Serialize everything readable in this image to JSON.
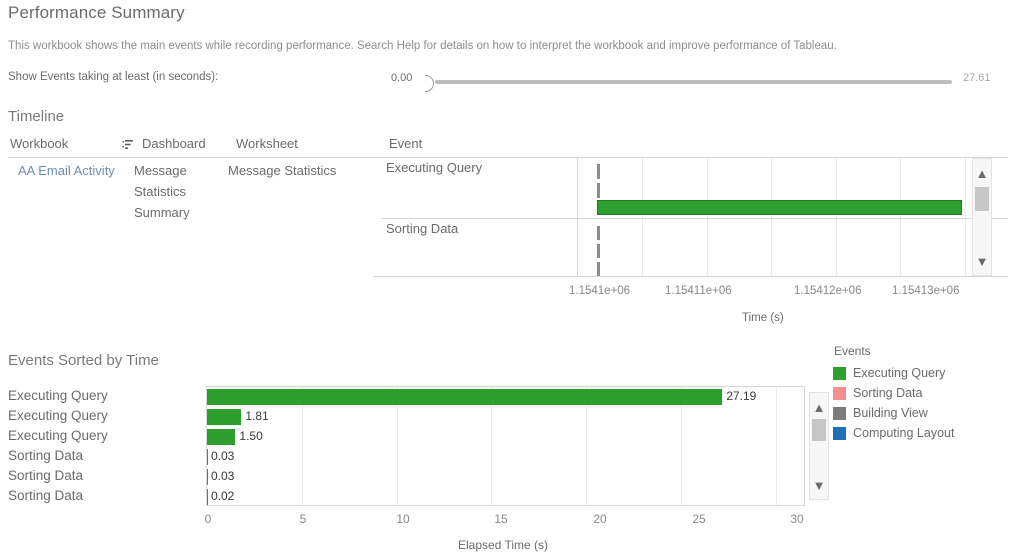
{
  "header": {
    "title": "Performance Summary",
    "description": "This workbook shows the main events while recording performance. Search Help for details on how to interpret the workbook and improve performance of Tableau.",
    "filter_label": "Show Events taking at least (in seconds):",
    "slider_min": "0.00",
    "slider_max": "27.61",
    "slider_value": 0.0
  },
  "timeline": {
    "section_title": "Timeline",
    "columns": {
      "workbook": "Workbook",
      "sort_icon": "sort-ascending-icon",
      "dashboard": "Dashboard",
      "worksheet": "Worksheet",
      "event": "Event"
    },
    "row": {
      "workbook": "AA Email Activity",
      "dashboard": "Message Statistics Summary",
      "worksheet": "Message Statistics"
    },
    "events": [
      {
        "name": "Executing Query"
      },
      {
        "name": "Sorting Data"
      }
    ],
    "axis": {
      "title": "Time (s)",
      "ticks": [
        "1.1541e+06",
        "1.15411e+06",
        "1.15412e+06",
        "1.15413e+06"
      ]
    },
    "scrollbar": {
      "up_arrow": "chevron-up-icon",
      "down_arrow": "chevron-down-icon"
    }
  },
  "events_sorted": {
    "section_title": "Events Sorted by Time",
    "axis": {
      "title": "Elapsed Time (s)",
      "ticks": [
        "0",
        "5",
        "10",
        "15",
        "20",
        "25",
        "30"
      ]
    },
    "scrollbar": {
      "up_arrow": "chevron-up-icon",
      "down_arrow": "chevron-down-icon"
    }
  },
  "legend": {
    "title": "Events",
    "items": [
      {
        "label": "Executing Query",
        "color": "#2e9e2e"
      },
      {
        "label": "Sorting Data",
        "color": "#f4918e"
      },
      {
        "label": "Building View",
        "color": "#7b7b7b"
      },
      {
        "label": "Computing Layout",
        "color": "#1f6fb4"
      }
    ]
  },
  "colors": {
    "bar_green": "#2e9e2e",
    "link_blue": "#6f8cb0",
    "text_gray": "#6b6b6b"
  },
  "chart_data": [
    {
      "type": "bar",
      "name": "timeline-gantt",
      "title": "Timeline",
      "xlabel": "Time (s)",
      "ylabel": "",
      "categories": [
        "Executing Query",
        "Sorting Data"
      ],
      "xticks": [
        "1.1541e+06",
        "1.15411e+06",
        "1.15412e+06",
        "1.15413e+06"
      ],
      "xlim": [
        1154095,
        1154135
      ],
      "grid": true,
      "legend": "right",
      "marks": [
        {
          "row": "Executing Query",
          "index": 0,
          "start_pct": 5.0,
          "width_pct": 0.7,
          "color": "#8c8c8c"
        },
        {
          "row": "Executing Query",
          "index": 1,
          "start_pct": 5.0,
          "width_pct": 0.7,
          "color": "#8c8c8c"
        },
        {
          "row": "Executing Query",
          "index": 2,
          "start_pct": 5.0,
          "width_pct": 94.0,
          "color": "#2e9e2e"
        },
        {
          "row": "Sorting Data",
          "index": 0,
          "start_pct": 5.0,
          "width_pct": 0.7,
          "color": "#8c8c8c"
        },
        {
          "row": "Sorting Data",
          "index": 1,
          "start_pct": 5.0,
          "width_pct": 0.7,
          "color": "#8c8c8c"
        },
        {
          "row": "Sorting Data",
          "index": 2,
          "start_pct": 5.0,
          "width_pct": 0.7,
          "color": "#8c8c8c"
        }
      ]
    },
    {
      "type": "bar",
      "name": "events-sorted-by-time",
      "title": "Events Sorted by Time",
      "xlabel": "Elapsed Time (s)",
      "ylabel": "",
      "orientation": "horizontal",
      "xlim": [
        0,
        31.5
      ],
      "xticks": [
        0,
        5,
        10,
        15,
        20,
        25,
        30
      ],
      "grid": true,
      "categories": [
        "Executing Query",
        "Executing Query",
        "Executing Query",
        "Sorting Data",
        "Sorting Data",
        "Sorting Data"
      ],
      "values": [
        27.19,
        1.81,
        1.5,
        0.03,
        0.03,
        0.02
      ],
      "labels": [
        "27.19",
        "1.81",
        "1.50",
        "0.03",
        "0.03",
        "0.02"
      ],
      "color": "#2e9e2e"
    }
  ]
}
